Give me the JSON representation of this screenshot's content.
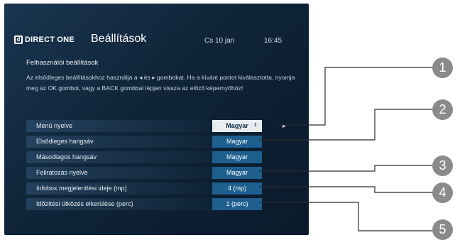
{
  "header": {
    "logo_text": "DIRECT ONE",
    "title": "Beállítások",
    "date": "Cs 10 jan",
    "time": "16:45"
  },
  "section": {
    "subtitle": "Felhasználói beállítások",
    "instructions": "Az elsődleges beállításokhoz használja a ◂ és ▸ gombokat. Ha a kívánt pontot kiválasztotta, nyomja meg az OK gombot, vagy a BACK gombbal lépjen vissza az előző képernyőhöz!"
  },
  "settings": [
    {
      "label": "Menü nyelve",
      "value": "Magyar"
    },
    {
      "label": "Elsődleges hangsáv",
      "value": "Magyar"
    },
    {
      "label": "Másodlagos hangsáv",
      "value": "Magyar"
    },
    {
      "label": "Feliratozás nyelve",
      "value": "Magyar"
    },
    {
      "label": "Infobox megjelenítési ideje (mp)",
      "value": "4 (mp)"
    },
    {
      "label": "Időzítési ütközés elkerülése (perc)",
      "value": "1 (perc)"
    }
  ],
  "callouts": [
    "1",
    "2",
    "3",
    "4",
    "5"
  ],
  "colors": {
    "callout": "#8a8a8a",
    "value_bg": "#1e5f8f",
    "selected_bg": "#e9edf2"
  }
}
